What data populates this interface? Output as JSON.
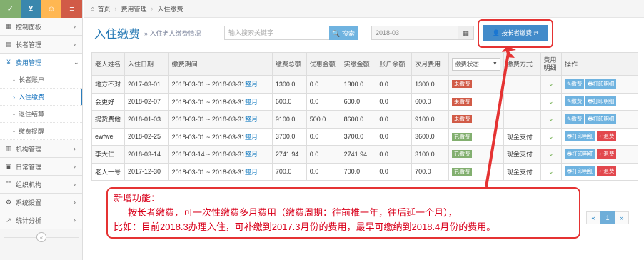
{
  "top_buttons": [
    "✓",
    "¥",
    "☺",
    "≡"
  ],
  "breadcrumb": [
    "首页",
    "费用管理",
    "入住缴费"
  ],
  "nav": {
    "items": [
      {
        "icon": "▦",
        "label": "控制面板"
      },
      {
        "icon": "▤",
        "label": "长者管理"
      },
      {
        "icon": "¥",
        "label": "费用管理"
      }
    ],
    "sub_items": [
      "长者账户",
      "入住缴费",
      "退住结算",
      "缴费提醒"
    ],
    "items2": [
      {
        "icon": "▥",
        "label": "机构管理"
      },
      {
        "icon": "▣",
        "label": "日常管理"
      },
      {
        "icon": "☷",
        "label": "组织机构"
      },
      {
        "icon": "⚙",
        "label": "系统设置"
      },
      {
        "icon": "↗",
        "label": "统计分析"
      }
    ]
  },
  "header": {
    "title": "入住缴费",
    "subtitle": "» 入住老人缴费情况"
  },
  "search": {
    "placeholder": "输入搜索关键字",
    "button": "🔍 搜索"
  },
  "date_value": "2018-03",
  "elder_pay_button": "👤 按长者缴费 ⇄",
  "table": {
    "columns": [
      "老人姓名",
      "入住日期",
      "缴费期间",
      "缴费总额",
      "优惠金额",
      "实缴金额",
      "账户余额",
      "次月费用",
      "缴费状态",
      "缴费方式",
      "费用明细",
      "操作"
    ],
    "status_select": "缴费状态",
    "rows": [
      {
        "name": "地方不对",
        "date": "2017-03-01",
        "period": "2018-03-01 ~ 2018-03-31",
        "link": "整月",
        "total": "1300.0",
        "discount": "0.0",
        "paid": "1300.0",
        "balance": "0.0",
        "next": "1300.0",
        "status": "未缴费",
        "method": "",
        "actions": [
          "✎缴费",
          "🖶打印明细"
        ]
      },
      {
        "name": "会更好",
        "date": "2018-02-07",
        "period": "2018-03-01 ~ 2018-03-31",
        "link": "整月",
        "total": "600.0",
        "discount": "0.0",
        "paid": "600.0",
        "balance": "0.0",
        "next": "600.0",
        "status": "未缴费",
        "method": "",
        "actions": [
          "✎缴费",
          "🖶打印明细"
        ]
      },
      {
        "name": "提货费他",
        "date": "2018-01-03",
        "period": "2018-03-01 ~ 2018-03-31",
        "link": "整月",
        "total": "9100.0",
        "discount": "500.0",
        "paid": "8600.0",
        "balance": "0.0",
        "next": "9100.0",
        "status": "未缴费",
        "method": "",
        "actions": [
          "✎缴费",
          "🖶打印明细"
        ]
      },
      {
        "name": "ewfwe",
        "date": "2018-02-25",
        "period": "2018-03-01 ~ 2018-03-31",
        "link": "整月",
        "total": "3700.0",
        "discount": "0.0",
        "paid": "3700.0",
        "balance": "0.0",
        "next": "3600.0",
        "status": "已缴费",
        "method": "现金支付",
        "actions": [
          "🖶打印明细",
          "↩退费"
        ]
      },
      {
        "name": "李大仁",
        "date": "2018-03-14",
        "period": "2018-03-14 ~ 2018-03-31",
        "link": "整月",
        "total": "2741.94",
        "discount": "0.0",
        "paid": "2741.94",
        "balance": "0.0",
        "next": "3100.0",
        "status": "已缴费",
        "method": "现金支付",
        "actions": [
          "🖶打印明细",
          "↩退费"
        ]
      },
      {
        "name": "老人一号",
        "date": "2017-12-30",
        "period": "2018-03-01 ~ 2018-03-31",
        "link": "整月",
        "total": "700.0",
        "discount": "0.0",
        "paid": "700.0",
        "balance": "0.0",
        "next": "700.0",
        "status": "已缴费",
        "method": "现金支付",
        "actions": [
          "🖶打印明细",
          "↩退费"
        ]
      }
    ]
  },
  "pagination": {
    "prev": "«",
    "page": "1",
    "next": "»"
  },
  "callout": {
    "line1": "新增功能：",
    "line2": "按长者缴费，可一次性缴费多月费用（缴费周期：往前推一年，往后延一个月），",
    "line3": "比如：目前2018.3办理入住，可补缴到2017.3月份的费用，最早可缴纳到2018.4月份的费用。"
  },
  "accent_color": "#e53333"
}
